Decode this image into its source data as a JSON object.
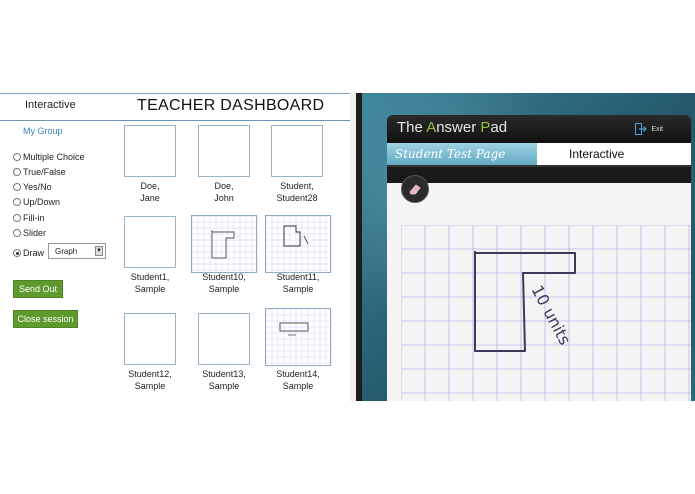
{
  "dashboard": {
    "app_label": "Interactive",
    "title": "TEACHER DASHBOARD",
    "group_link": "My Group",
    "question_types": [
      {
        "label": "Multiple Choice",
        "selected": false
      },
      {
        "label": "True/False",
        "selected": false
      },
      {
        "label": "Yes/No",
        "selected": false
      },
      {
        "label": "Up/Down",
        "selected": false
      },
      {
        "label": "Fill-in",
        "selected": false
      },
      {
        "label": "Slider",
        "selected": false
      },
      {
        "label": "Draw",
        "selected": true
      }
    ],
    "draw_option": "Graph",
    "send_out_label": "Send Out",
    "close_session_label": "Close session",
    "students": [
      {
        "line1": "Doe,",
        "line2": "Jane",
        "thumbnail": "blank"
      },
      {
        "line1": "Doe,",
        "line2": "John",
        "thumbnail": "blank"
      },
      {
        "line1": "Student,",
        "line2": "Student28",
        "thumbnail": "blank"
      },
      {
        "line1": "Student1,",
        "line2": "Sample",
        "thumbnail": "blank"
      },
      {
        "line1": "Student10,",
        "line2": "Sample",
        "thumbnail": "graph-drawing"
      },
      {
        "line1": "Student11,",
        "line2": "Sample",
        "thumbnail": "graph-drawing"
      },
      {
        "line1": "Student12,",
        "line2": "Sample",
        "thumbnail": "blank"
      },
      {
        "line1": "Student13,",
        "line2": "Sample",
        "thumbnail": "blank"
      },
      {
        "line1": "Student14,",
        "line2": "Sample",
        "thumbnail": "graph-drawing"
      }
    ]
  },
  "student_app": {
    "title_parts": [
      "The ",
      "A",
      "nswer ",
      "P",
      "ad"
    ],
    "exit_label": "Exit",
    "exit_icon": "exit-door-icon",
    "tabs": {
      "student": "Student Test Page",
      "interactive": "Interactive"
    },
    "eraser_icon": "eraser-icon",
    "drawing_annotation": "10 units"
  },
  "colors": {
    "accent_green": "#5f9a2e",
    "title_accent": "#8cc63f",
    "link_blue": "#3a84c6",
    "tab_blue": "#62a9c2",
    "grid_line": "#b9b4e6",
    "ink": "#3a3a5a"
  }
}
